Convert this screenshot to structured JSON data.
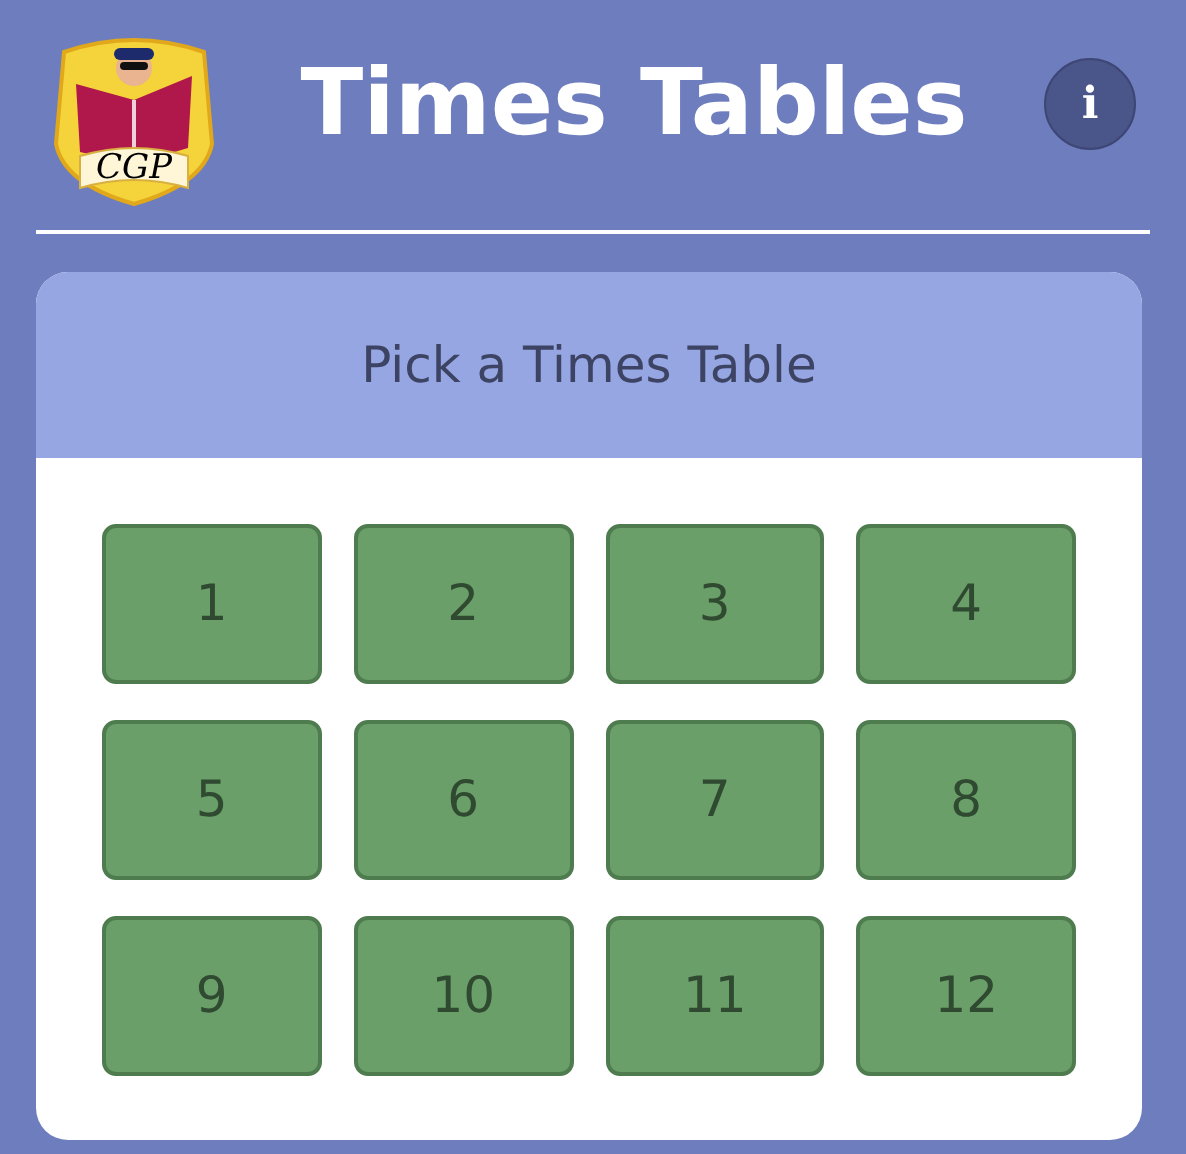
{
  "header": {
    "logo": {
      "text": "CGP"
    },
    "title": "Times Tables",
    "info_button": "i"
  },
  "card": {
    "heading": "Pick a Times Table",
    "tables": [
      "1",
      "2",
      "3",
      "4",
      "5",
      "6",
      "7",
      "8",
      "9",
      "10",
      "11",
      "12"
    ]
  }
}
